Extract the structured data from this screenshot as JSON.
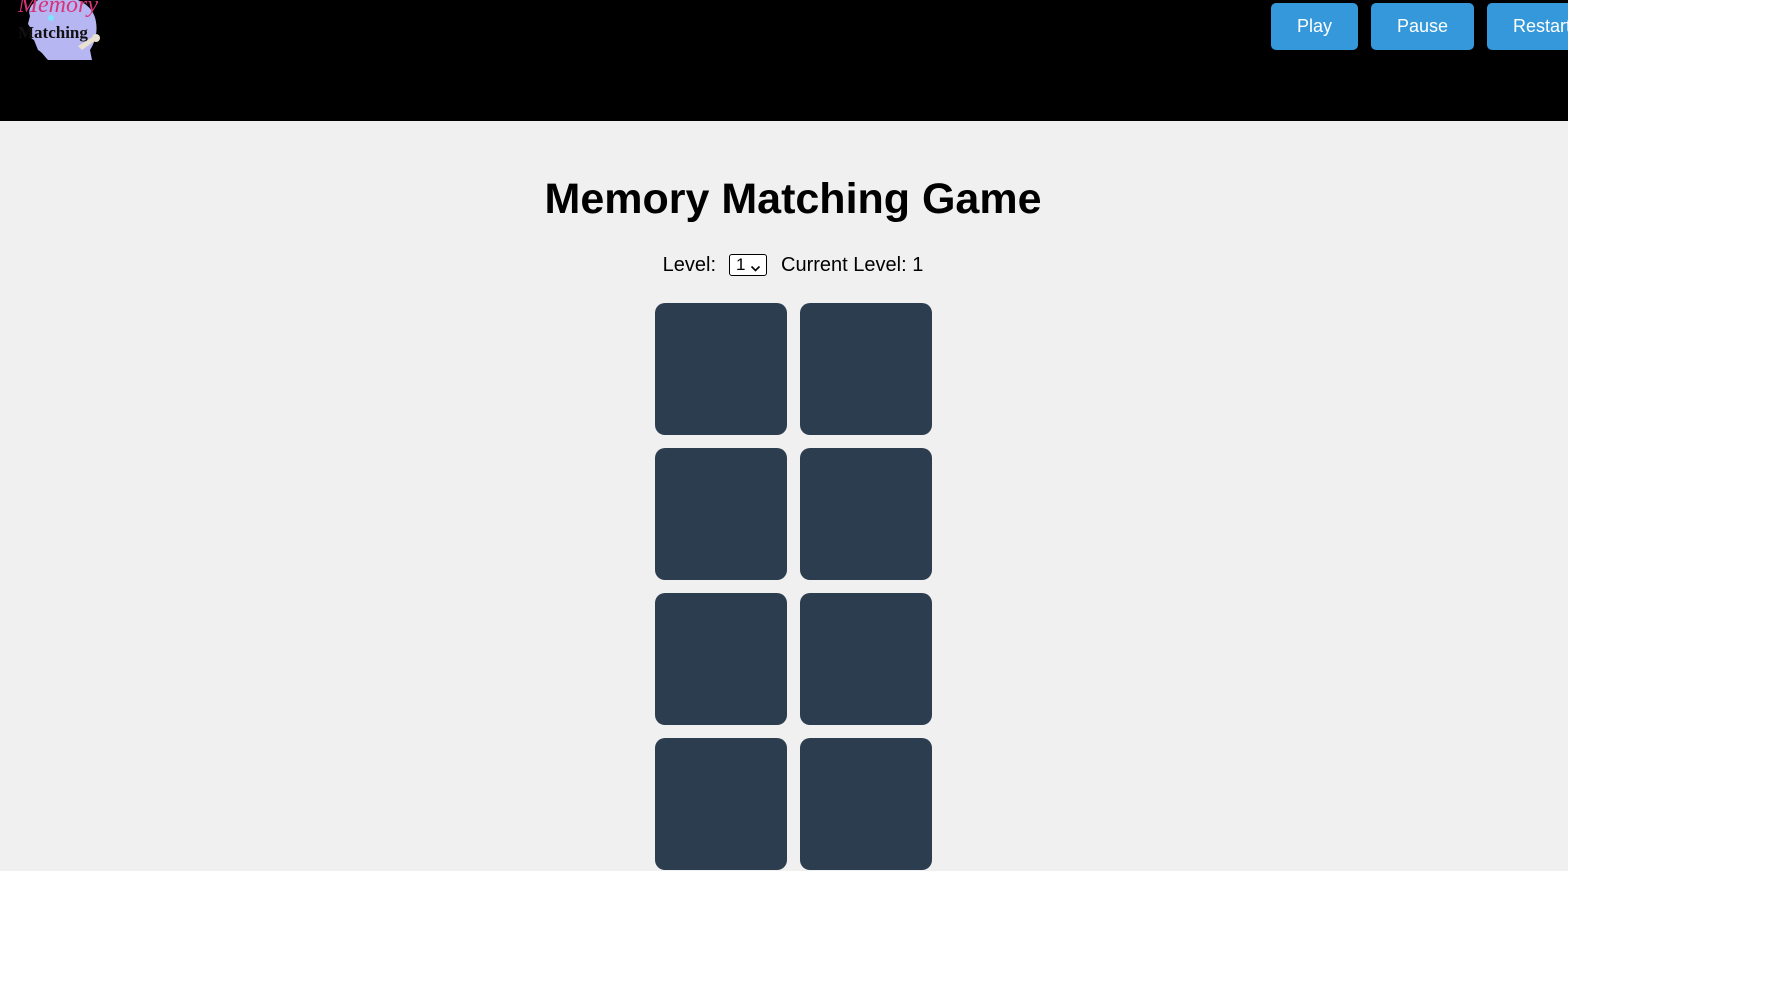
{
  "header": {
    "logo": {
      "line1": "Memory",
      "line2": "Matching"
    },
    "buttons": {
      "play": "Play",
      "pause": "Pause",
      "restart": "Restart"
    },
    "button_color": "#3498db",
    "background_color": "#000000"
  },
  "main": {
    "title": "Memory Matching Game",
    "level_label": "Level:",
    "level_select_value": "1",
    "current_level_text": "Current Level: 1",
    "card_color": "#2d3d50",
    "card_count": 8,
    "cards_face_down": true
  },
  "page_background": "#f0f0f0"
}
